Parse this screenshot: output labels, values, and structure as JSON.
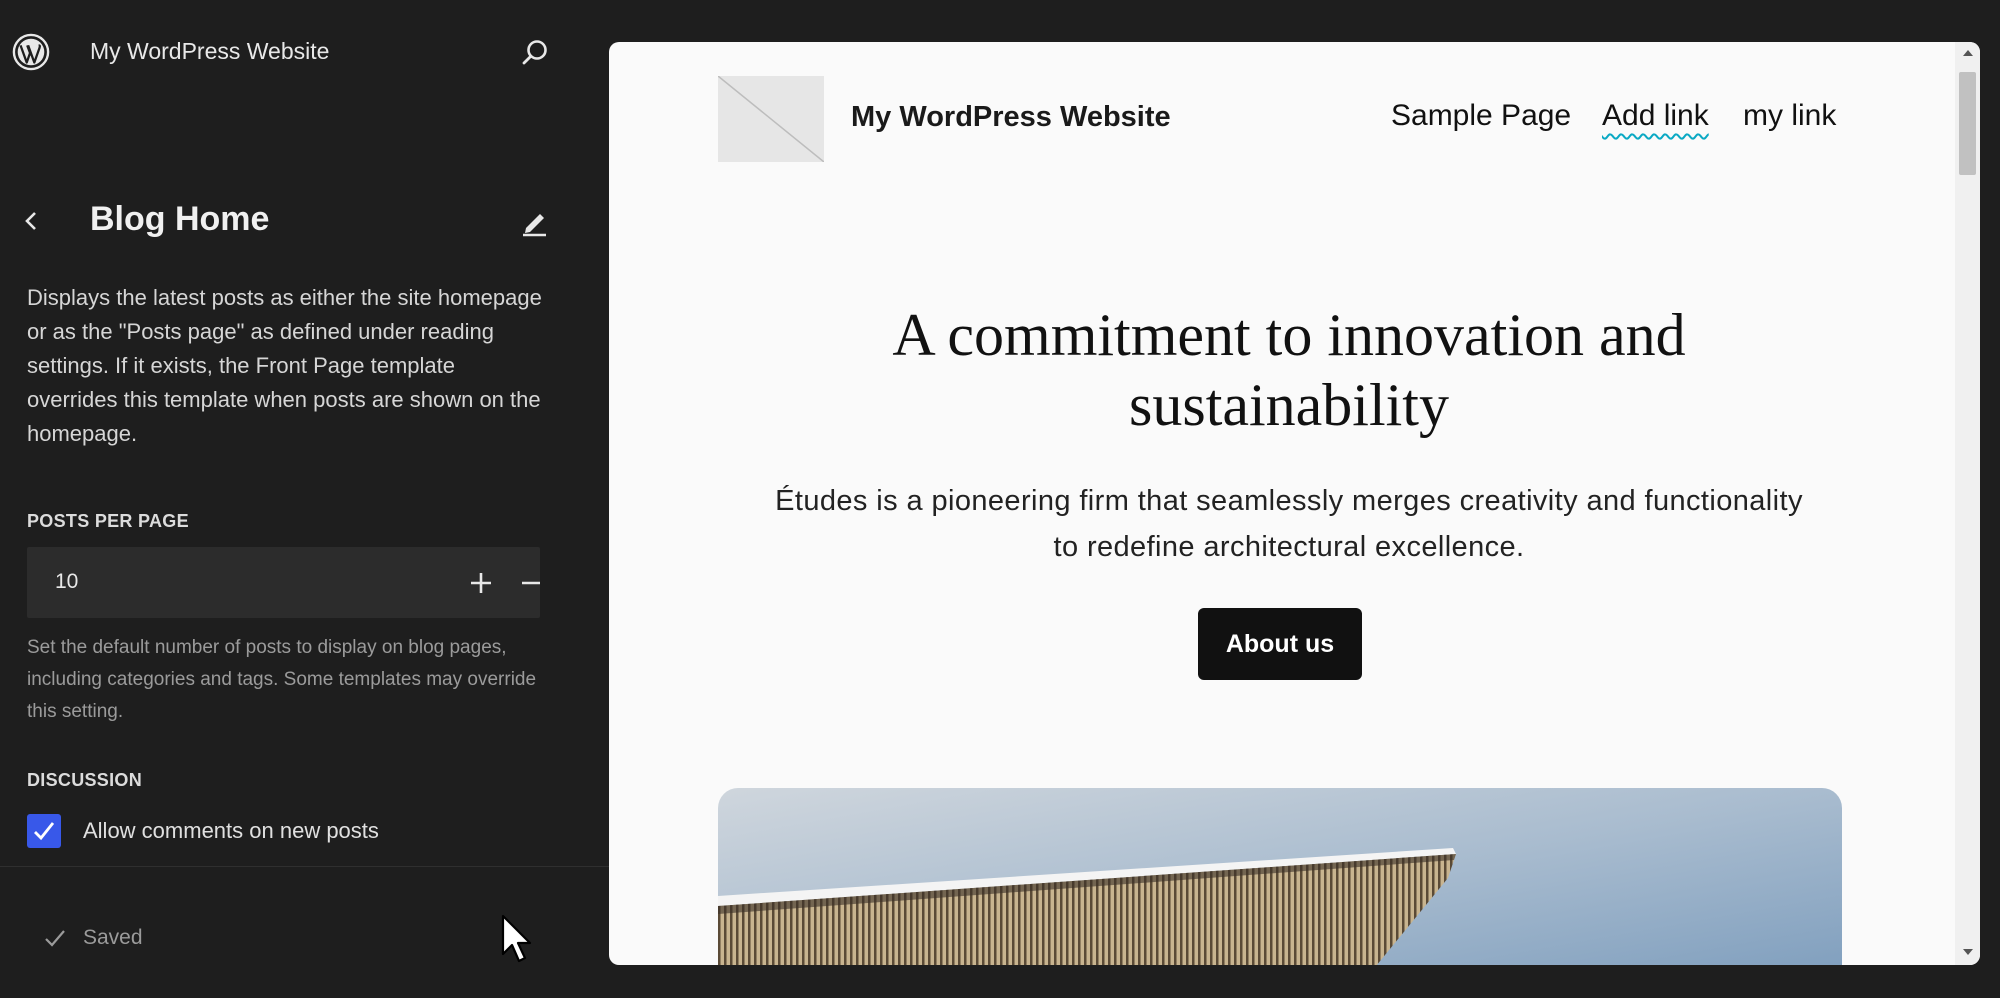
{
  "sidebar": {
    "site_name": "My WordPress Website",
    "title": "Blog Home",
    "description": "Displays the latest posts as either the site homepage or as the \"Posts page\" as defined under reading settings. If it exists, the Front Page template overrides this template when posts are shown on the homepage.",
    "posts_per_page": {
      "label": "POSTS PER PAGE",
      "value": "10",
      "help": "Set the default number of posts to display on blog pages, including categories and tags. Some templates may override this setting."
    },
    "discussion": {
      "label": "DISCUSSION",
      "checkbox_label": "Allow comments on new posts",
      "checked": true
    },
    "status": "Saved",
    "icons": {
      "logo": "wordpress-logo-icon",
      "search": "search-icon",
      "back": "chevron-left-icon",
      "edit": "pencil-icon",
      "plus": "plus-icon",
      "minus": "minus-icon",
      "check": "checkmark-icon"
    }
  },
  "preview": {
    "site_title": "My WordPress Website",
    "nav": [
      "Sample Page",
      "Add link",
      "my link"
    ],
    "hero_title": "A commitment to innovation and sustainability",
    "hero_subtitle": "Études is a pioneering firm that seamlessly merges creativity and functionality to redefine architectural excellence.",
    "cta_label": "About us"
  },
  "colors": {
    "sidebar_bg": "#1e1e1e",
    "accent": "#3858e9",
    "preview_bg": "#fafafa",
    "button_bg": "#111111"
  }
}
